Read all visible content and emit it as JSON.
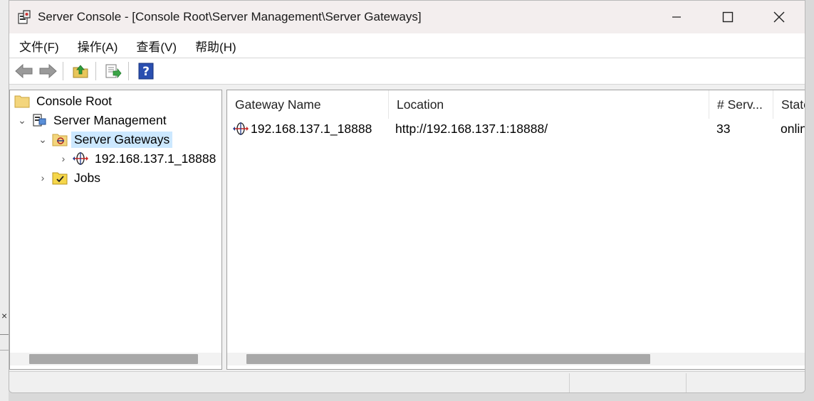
{
  "window": {
    "title": "Server Console - [Console Root\\Server Management\\Server Gateways]",
    "controls": {
      "minimize": "—",
      "maximize": "☐",
      "close": "✕"
    }
  },
  "menu": [
    {
      "label": "文件(F)"
    },
    {
      "label": "操作(A)"
    },
    {
      "label": "查看(V)"
    },
    {
      "label": "帮助(H)"
    }
  ],
  "toolbar": {
    "buttons": [
      "back-arrow-icon",
      "forward-arrow-icon",
      "up-folder-icon",
      "export-list-icon",
      "help-icon"
    ]
  },
  "tree": {
    "items": [
      {
        "label": "Console Root",
        "icon": "folder-icon",
        "expander": ""
      },
      {
        "label": "Server Management",
        "icon": "server-management-icon",
        "expander": "⌄"
      },
      {
        "label": "Server Gateways",
        "icon": "gateways-folder-icon",
        "expander": "⌄",
        "selected": true
      },
      {
        "label": "192.168.137.1_18888",
        "icon": "gateway-icon",
        "expander": "›"
      },
      {
        "label": "Jobs",
        "icon": "jobs-folder-icon",
        "expander": "›"
      }
    ]
  },
  "list": {
    "columns": [
      "Gateway Name",
      "Location",
      "# Serv...",
      "State"
    ],
    "rows": [
      {
        "name": "192.168.137.1_18888",
        "location": "http://192.168.137.1:18888/",
        "servers": "33",
        "state": "online"
      }
    ]
  },
  "colors": {
    "selection": "#cce8ff",
    "titlebar": "#f3eeee",
    "scroll_thumb": "#a8a8a8"
  }
}
